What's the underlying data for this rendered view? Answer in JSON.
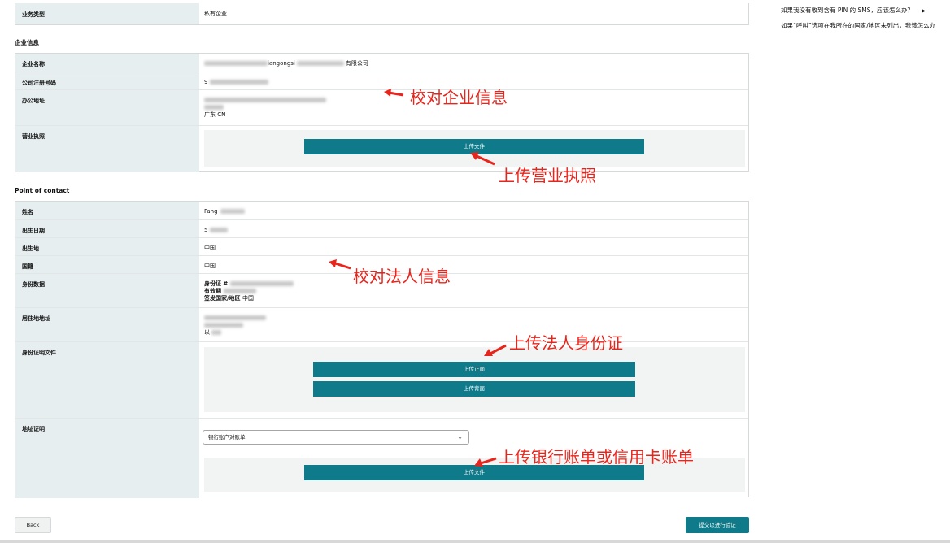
{
  "sidebar": {
    "links": [
      {
        "label": "如果我没有收到含有 PIN 的 SMS，应该怎么办？",
        "arrow": "▶"
      },
      {
        "label": "如果“呼叫”选项在我所在的国家/地区未列出，我该怎么办"
      }
    ]
  },
  "business_type": {
    "label": "业务类型",
    "value": "私有企业"
  },
  "company": {
    "title": "企业信息",
    "name_label": "企业名称",
    "name_value": "iangongsi",
    "name_suffix": "有限公司",
    "reg_label": "公司注册号码",
    "reg_value": "9",
    "address_label": "办公地址",
    "address_line3": "广东 CN",
    "license_label": "营业执照",
    "upload_label": "上传文件"
  },
  "contact": {
    "title": "Point of contact",
    "name_label": "姓名",
    "name_value": "Fang",
    "dob_label": "出生日期",
    "dob_value": "5",
    "pob_label": "出生地",
    "pob_value": "中国",
    "nationality_label": "国籍",
    "nationality_value": "中国",
    "id_label": "身份数据",
    "id_number_label": "身份证 #",
    "id_expiry_label": "有效期",
    "id_country_label": "签发国家/地区",
    "id_country_value": "中国",
    "residence_label": "居住地地址",
    "residence_line3": "以",
    "id_doc_label": "身份证明文件",
    "upload_front": "上传正面",
    "upload_back": "上传背面",
    "proof_label": "地址证明",
    "proof_select": "银行账户对账单",
    "proof_upload": "上传文件"
  },
  "footer": {
    "back": "Back",
    "submit": "提交以进行验证"
  },
  "annotations": {
    "a1": "校对企业信息",
    "a2": "上传营业执照",
    "a3": "校对法人信息",
    "a4": "上传法人身份证",
    "a5": "上传银行账单或信用卡账单"
  },
  "colors": {
    "accent": "#0f7a8a",
    "annotation": "#e8251c",
    "label_bg": "#e7eef0"
  }
}
